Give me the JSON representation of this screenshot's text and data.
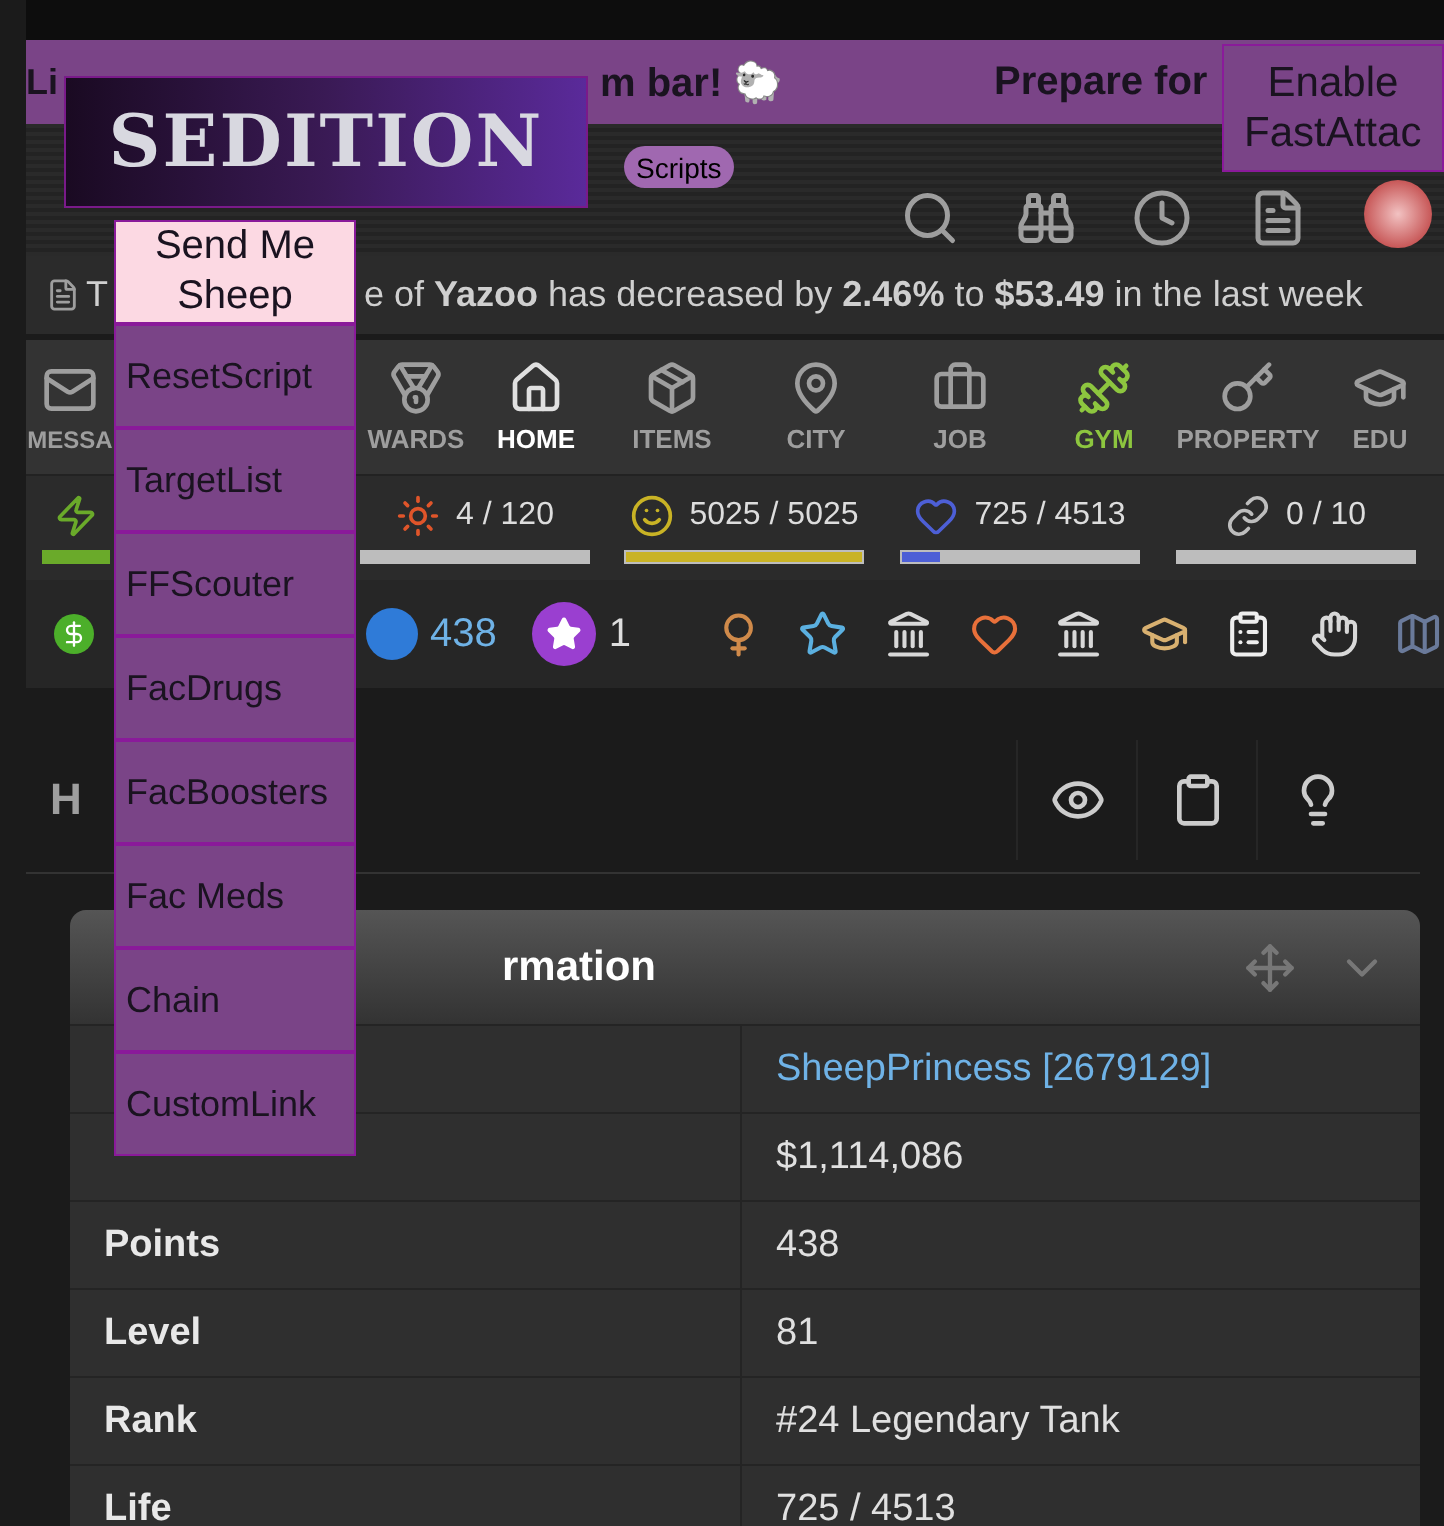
{
  "banner": {
    "fragments": [
      "Li",
      "m bar! 🐑",
      "Prepare for"
    ]
  },
  "logo": {
    "text": "SEDITION"
  },
  "fast_attack_button": "Enable FastAttac",
  "scripts_badge": "Scripts",
  "script_menu": [
    {
      "label": "Send Me Sheep",
      "kind": "toggle"
    },
    {
      "label": "ResetScript",
      "kind": "item"
    },
    {
      "label": "TargetList",
      "kind": "item"
    },
    {
      "label": "FFScouter",
      "kind": "item"
    },
    {
      "label": "FacDrugs",
      "kind": "item"
    },
    {
      "label": "FacBoosters",
      "kind": "item"
    },
    {
      "label": "Fac Meds",
      "kind": "item"
    },
    {
      "label": "Chain",
      "kind": "item"
    },
    {
      "label": "CustomLink",
      "kind": "item"
    }
  ],
  "ticker": {
    "lead": "T",
    "text": "e of **Yazoo** has decreased by **2.46%** to **$53.49** in the last week"
  },
  "nav": [
    {
      "label": "MESSA",
      "kind": "mail",
      "color": "#9e9e9e"
    },
    {
      "label": "WARDS",
      "kind": "medal",
      "color": "#9e9e9e"
    },
    {
      "label": "HOME",
      "kind": "home",
      "color": "#ffffff"
    },
    {
      "label": "ITEMS",
      "kind": "box",
      "color": "#9e9e9e"
    },
    {
      "label": "CITY",
      "kind": "pin",
      "color": "#9e9e9e"
    },
    {
      "label": "JOB",
      "kind": "case",
      "color": "#9e9e9e"
    },
    {
      "label": "GYM",
      "kind": "gym",
      "color": "#8dc63f"
    },
    {
      "label": "PROPERTY",
      "kind": "key",
      "color": "#9e9e9e"
    },
    {
      "label": "EDU",
      "kind": "cap",
      "color": "#9e9e9e"
    }
  ],
  "bars": [
    {
      "kind": "energy",
      "color": "#6aaa2a"
    },
    {
      "kind": "nerve",
      "value": "4 / 120",
      "color": "#e0552a"
    },
    {
      "kind": "happy",
      "value": "5025 / 5025",
      "level": 1,
      "color": "#c9b325"
    },
    {
      "kind": "life",
      "value": "725 / 4513",
      "level": 0.16,
      "color": "#4d5fd6"
    },
    {
      "kind": "chain",
      "value": "0 / 10"
    }
  ],
  "currencies": [
    {
      "kind": "points",
      "value": "438"
    },
    {
      "kind": "merits",
      "value": "1"
    }
  ],
  "section": {
    "title": "H"
  },
  "card": {
    "title": "rmation",
    "rows": [
      {
        "value": "SheepPrincess [2679129]",
        "kind": "link"
      },
      {
        "value": "$1,114,086",
        "kind": "text"
      },
      {
        "label": "Points",
        "value": "438",
        "kind": "text"
      },
      {
        "label": "Level",
        "value": "81",
        "kind": "text"
      },
      {
        "label": "Rank",
        "value": "#24 Legendary Tank",
        "kind": "text"
      },
      {
        "label": "Life",
        "value": "725 / 4513",
        "kind": "text"
      }
    ]
  }
}
